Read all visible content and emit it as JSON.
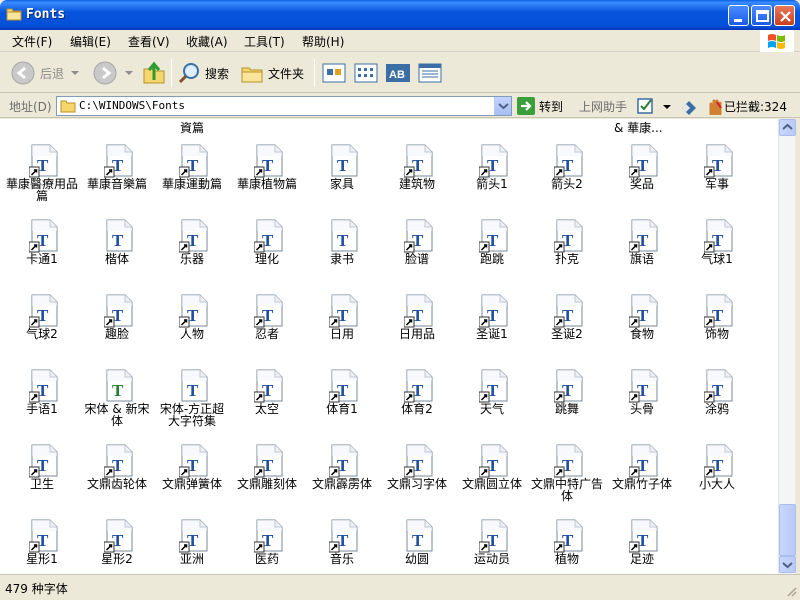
{
  "window": {
    "title": "Fonts"
  },
  "menu": [
    {
      "label": "文件(F)"
    },
    {
      "label": "编辑(E)"
    },
    {
      "label": "查看(V)"
    },
    {
      "label": "收藏(A)"
    },
    {
      "label": "工具(T)"
    },
    {
      "label": "帮助(H)"
    }
  ],
  "toolbar": {
    "back_label": "后退",
    "search_label": "搜索",
    "folders_label": "文件夹"
  },
  "address": {
    "label": "地址(D)",
    "path": "C:\\WINDOWS\\Fonts",
    "go_label": "转到",
    "helper_label": "上网助手",
    "blocked_label": "已拦截:324"
  },
  "partial_row": [
    "資篇",
    "& 華康..."
  ],
  "fonts": [
    {
      "name": "華康醫療用品篇",
      "shortcut": true
    },
    {
      "name": "華康音樂篇",
      "shortcut": true
    },
    {
      "name": "華康運動篇",
      "shortcut": true
    },
    {
      "name": "華康植物篇",
      "shortcut": true
    },
    {
      "name": "家具",
      "shortcut": false
    },
    {
      "name": "建筑物",
      "shortcut": true
    },
    {
      "name": "箭头1",
      "shortcut": true
    },
    {
      "name": "箭头2",
      "shortcut": true
    },
    {
      "name": "奖品",
      "shortcut": true
    },
    {
      "name": "军事",
      "shortcut": true
    },
    {
      "name": "卡通1",
      "shortcut": true
    },
    {
      "name": "楷体",
      "shortcut": false
    },
    {
      "name": "乐器",
      "shortcut": true
    },
    {
      "name": "理化",
      "shortcut": true
    },
    {
      "name": "隶书",
      "shortcut": false
    },
    {
      "name": "脸谱",
      "shortcut": true
    },
    {
      "name": "跑跳",
      "shortcut": true
    },
    {
      "name": "扑克",
      "shortcut": true
    },
    {
      "name": "旗语",
      "shortcut": true
    },
    {
      "name": "气球1",
      "shortcut": true
    },
    {
      "name": "气球2",
      "shortcut": true
    },
    {
      "name": "趣脸",
      "shortcut": true
    },
    {
      "name": "人物",
      "shortcut": true
    },
    {
      "name": "忍者",
      "shortcut": true
    },
    {
      "name": "日用",
      "shortcut": true
    },
    {
      "name": "日用品",
      "shortcut": true
    },
    {
      "name": "圣诞1",
      "shortcut": true
    },
    {
      "name": "圣诞2",
      "shortcut": true
    },
    {
      "name": "食物",
      "shortcut": true
    },
    {
      "name": "饰物",
      "shortcut": true
    },
    {
      "name": "手语1",
      "shortcut": true
    },
    {
      "name": "宋体 & 新宋体",
      "shortcut": false,
      "truetype_green": true
    },
    {
      "name": "宋体-方正超大字符集",
      "shortcut": false
    },
    {
      "name": "太空",
      "shortcut": true
    },
    {
      "name": "体育1",
      "shortcut": true
    },
    {
      "name": "体育2",
      "shortcut": true
    },
    {
      "name": "天气",
      "shortcut": true
    },
    {
      "name": "跳舞",
      "shortcut": true
    },
    {
      "name": "头骨",
      "shortcut": true
    },
    {
      "name": "涂鸦",
      "shortcut": true
    },
    {
      "name": "卫生",
      "shortcut": true
    },
    {
      "name": "文鼎齿轮体",
      "shortcut": true
    },
    {
      "name": "文鼎弹簧体",
      "shortcut": true
    },
    {
      "name": "文鼎雕刻体",
      "shortcut": true
    },
    {
      "name": "文鼎霹雳体",
      "shortcut": true
    },
    {
      "name": "文鼎习字体",
      "shortcut": true
    },
    {
      "name": "文鼎圆立体",
      "shortcut": true
    },
    {
      "name": "文鼎中特广告体",
      "shortcut": true
    },
    {
      "name": "文鼎竹子体",
      "shortcut": true
    },
    {
      "name": "小大人",
      "shortcut": true
    },
    {
      "name": "星形1",
      "shortcut": true
    },
    {
      "name": "星形2",
      "shortcut": true
    },
    {
      "name": "亚洲",
      "shortcut": true
    },
    {
      "name": "医药",
      "shortcut": true
    },
    {
      "name": "音乐",
      "shortcut": true
    },
    {
      "name": "幼圆",
      "shortcut": false
    },
    {
      "name": "运动员",
      "shortcut": true
    },
    {
      "name": "植物",
      "shortcut": true
    },
    {
      "name": "足迹",
      "shortcut": true
    }
  ],
  "status": {
    "text": "479 种字体"
  }
}
